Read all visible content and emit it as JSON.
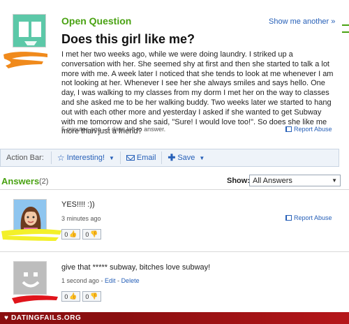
{
  "question": {
    "status": "Open Question",
    "show_more": "Show me another »",
    "title": "Does this girl like me?",
    "body": "I met her two weeks ago, while we were doing laundry. I striked up a conversation with her. She seemed shy at first and then she started to talk a lot more with me. A week later I noticed that she tends to look at me whenever I am not looking at her. Whenever I see her she always smiles and says hello. One day, I was walking to my classes from my dorm I met her on the way to classes and she asked me to be her walking buddy. Two weeks later we started to hang out with each other more and yesterday I asked if she wanted to get Subway with me tomorrow and she said, \"Sure! I would love too!\". So does she like me more than just a friend?",
    "meta": "5 minutes ago - 4 days left to answer.",
    "report": "Report Abuse",
    "avatar_icon": "exclamation-icon",
    "avatar_color": "#5cc8a8"
  },
  "action_bar": {
    "label": "Action Bar:",
    "interesting": "Interesting!",
    "email": "Email",
    "save": "Save"
  },
  "answers_header": {
    "title": "Answers",
    "count": "(2)",
    "show_label": "Show:",
    "show_value": "All Answers"
  },
  "answers": [
    {
      "text": "YES!!!! :))",
      "meta": "3 minutes ago",
      "report": "Report Abuse",
      "thumbs_up": "0",
      "thumbs_down": "0",
      "avatar_icon": "girl-avatar-icon"
    },
    {
      "text": "give that ***** subway, bitches love subway!",
      "meta_time": "1 second ago - ",
      "edit": "Edit",
      "sep": " - ",
      "delete": "Delete",
      "thumbs_up": "0",
      "thumbs_down": "0",
      "avatar_icon": "default-avatar-icon"
    }
  ],
  "footer": {
    "logo_text": "DATINGFAILS.ORG"
  },
  "colors": {
    "accent_green": "#49a212",
    "link_blue": "#2760b8",
    "footer_red": "#8a0f10"
  }
}
